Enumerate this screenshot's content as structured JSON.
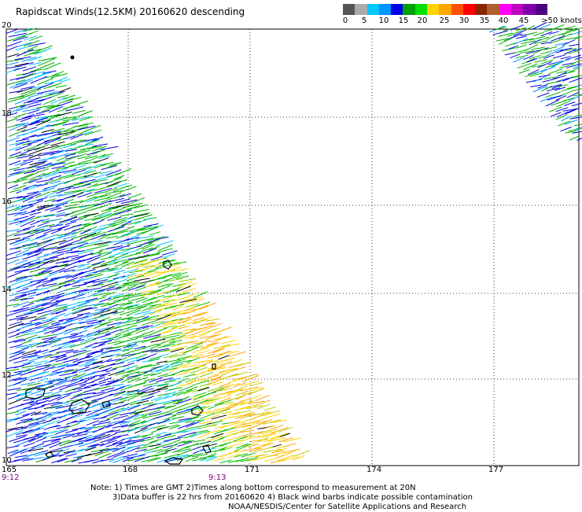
{
  "title": "Rapidscat Winds(12.5KM) 20160620 descending",
  "legend": {
    "colors": [
      "#555555",
      "#aaaaaa",
      "#00c8ff",
      "#0096ff",
      "#0000e6",
      "#00a000",
      "#00e000",
      "#ffd200",
      "#ffa500",
      "#ff5000",
      "#ff0000",
      "#8b2500",
      "#b06030",
      "#ff00ff",
      "#c000c0",
      "#8000b0",
      "#4b0082"
    ],
    "labels": [
      "0",
      "5",
      "10",
      "15",
      "20",
      "25",
      "30",
      "35",
      "40",
      "45",
      ">50 knots"
    ]
  },
  "axes": {
    "lat_labels": [
      "20",
      "18",
      "16",
      "14",
      "12",
      "10"
    ],
    "lon_labels": [
      "165",
      "168",
      "171",
      "174",
      "177"
    ],
    "time_labels": [
      "9:12",
      "9:13"
    ]
  },
  "notes": [
    "Note: 1) Times are GMT 2)Times along bottom correspond to measurement at 20N",
    "3)Data buffer is 22 hrs from 20160620 4) Black wind barbs indicate possible contamination",
    "NOAA/NESDIS/Center for Satellite Applications and Research"
  ]
}
